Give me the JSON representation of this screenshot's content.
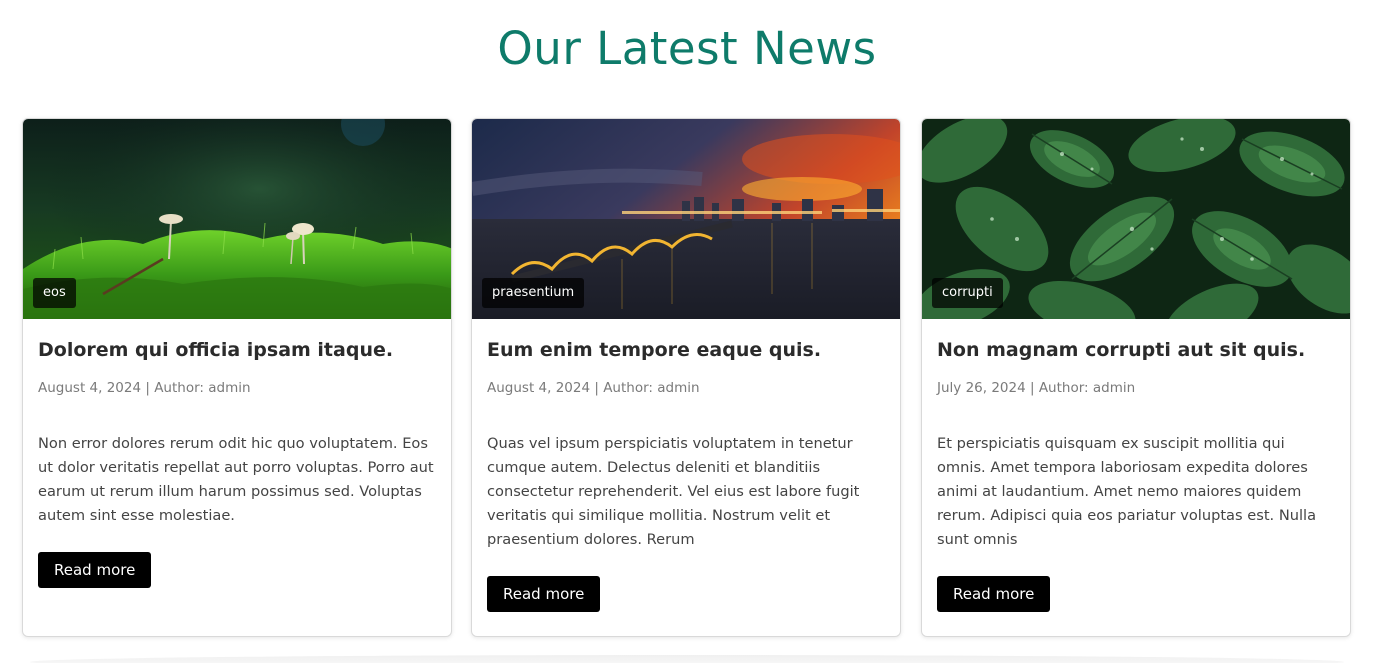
{
  "section": {
    "title": "Our Latest News",
    "title_color": "#0e7b6a"
  },
  "posts": [
    {
      "image": "forest-moss-mushrooms",
      "tag": "eos",
      "title": "Dolorem qui officia ipsam itaque.",
      "meta": "August 4, 2024 | Author: admin",
      "excerpt": "Non error dolores rerum odit hic quo voluptatem. Eos ut dolor veritatis repellat aut porro voluptas. Porro aut earum ut rerum illum harum possimus sed. Voluptas autem sint esse molestiae.",
      "button": "Read more"
    },
    {
      "image": "city-bridge-sunset",
      "tag": "praesentium",
      "title": "Eum enim tempore eaque quis.",
      "meta": "August 4, 2024 | Author: admin",
      "excerpt": "Quas vel ipsum perspiciatis voluptatem in tenetur cumque autem. Delectus deleniti et blanditiis consectetur reprehenderit. Vel eius est labore fugit veritatis qui similique mollitia. Nostrum velit et praesentium dolores. Rerum",
      "button": "Read more"
    },
    {
      "image": "green-leaves-droplets",
      "tag": "corrupti",
      "title": "Non magnam corrupti aut sit quis.",
      "meta": "July 26, 2024 | Author: admin",
      "excerpt": "Et perspiciatis quisquam ex suscipit mollitia qui omnis. Amet tempora laboriosam expedita dolores animi at laudantium. Amet nemo maiores quidem rerum. Adipisci quia eos pariatur voluptas est. Nulla sunt omnis",
      "button": "Read more"
    }
  ]
}
